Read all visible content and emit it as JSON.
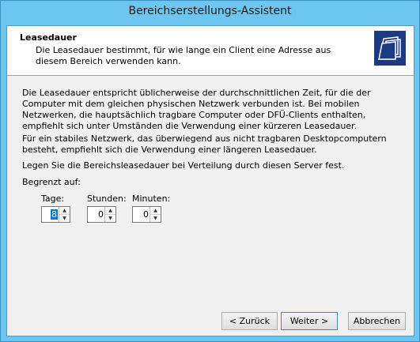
{
  "window": {
    "title": "Bereichserstellungs-Assistent"
  },
  "header": {
    "title": "Leasedauer",
    "description": "Die Leasedauer bestimmt, für wie lange ein Client eine Adresse aus diesem Bereich verwenden kann."
  },
  "body": {
    "para1": "Die Leasedauer entspricht üblicherweise der durchschnittlichen Zeit, für die der Computer mit dem gleichen physischen Netzwerk verbunden ist. Bei mobilen Netzwerken, die hauptsächlich tragbare Computer oder DFÜ-Clients enthalten, empfiehlt sich unter Umständen die Verwendung einer kürzeren Leasedauer.",
    "para2": "Für ein stabiles Netzwerk, das überwiegend aus nicht tragbaren Desktopcomputern besteht, empfiehlt sich die Verwendung einer längeren Leasedauer.",
    "para3": "Legen Sie die Bereichsleasedauer bei Verteilung durch diesen Server fest.",
    "limited_label": "Begrenzt auf:"
  },
  "fields": {
    "days": {
      "label": "Tage:",
      "value": "8"
    },
    "hours": {
      "label": "Stunden:",
      "value": "0"
    },
    "minutes": {
      "label": "Minuten:",
      "value": "0"
    }
  },
  "buttons": {
    "back": "< Zurück",
    "next": "Weiter >",
    "cancel": "Abbrechen"
  },
  "icons": {
    "header_icon": "folders-icon",
    "spin_up": "arrow-up-icon",
    "spin_down": "arrow-down-icon"
  }
}
